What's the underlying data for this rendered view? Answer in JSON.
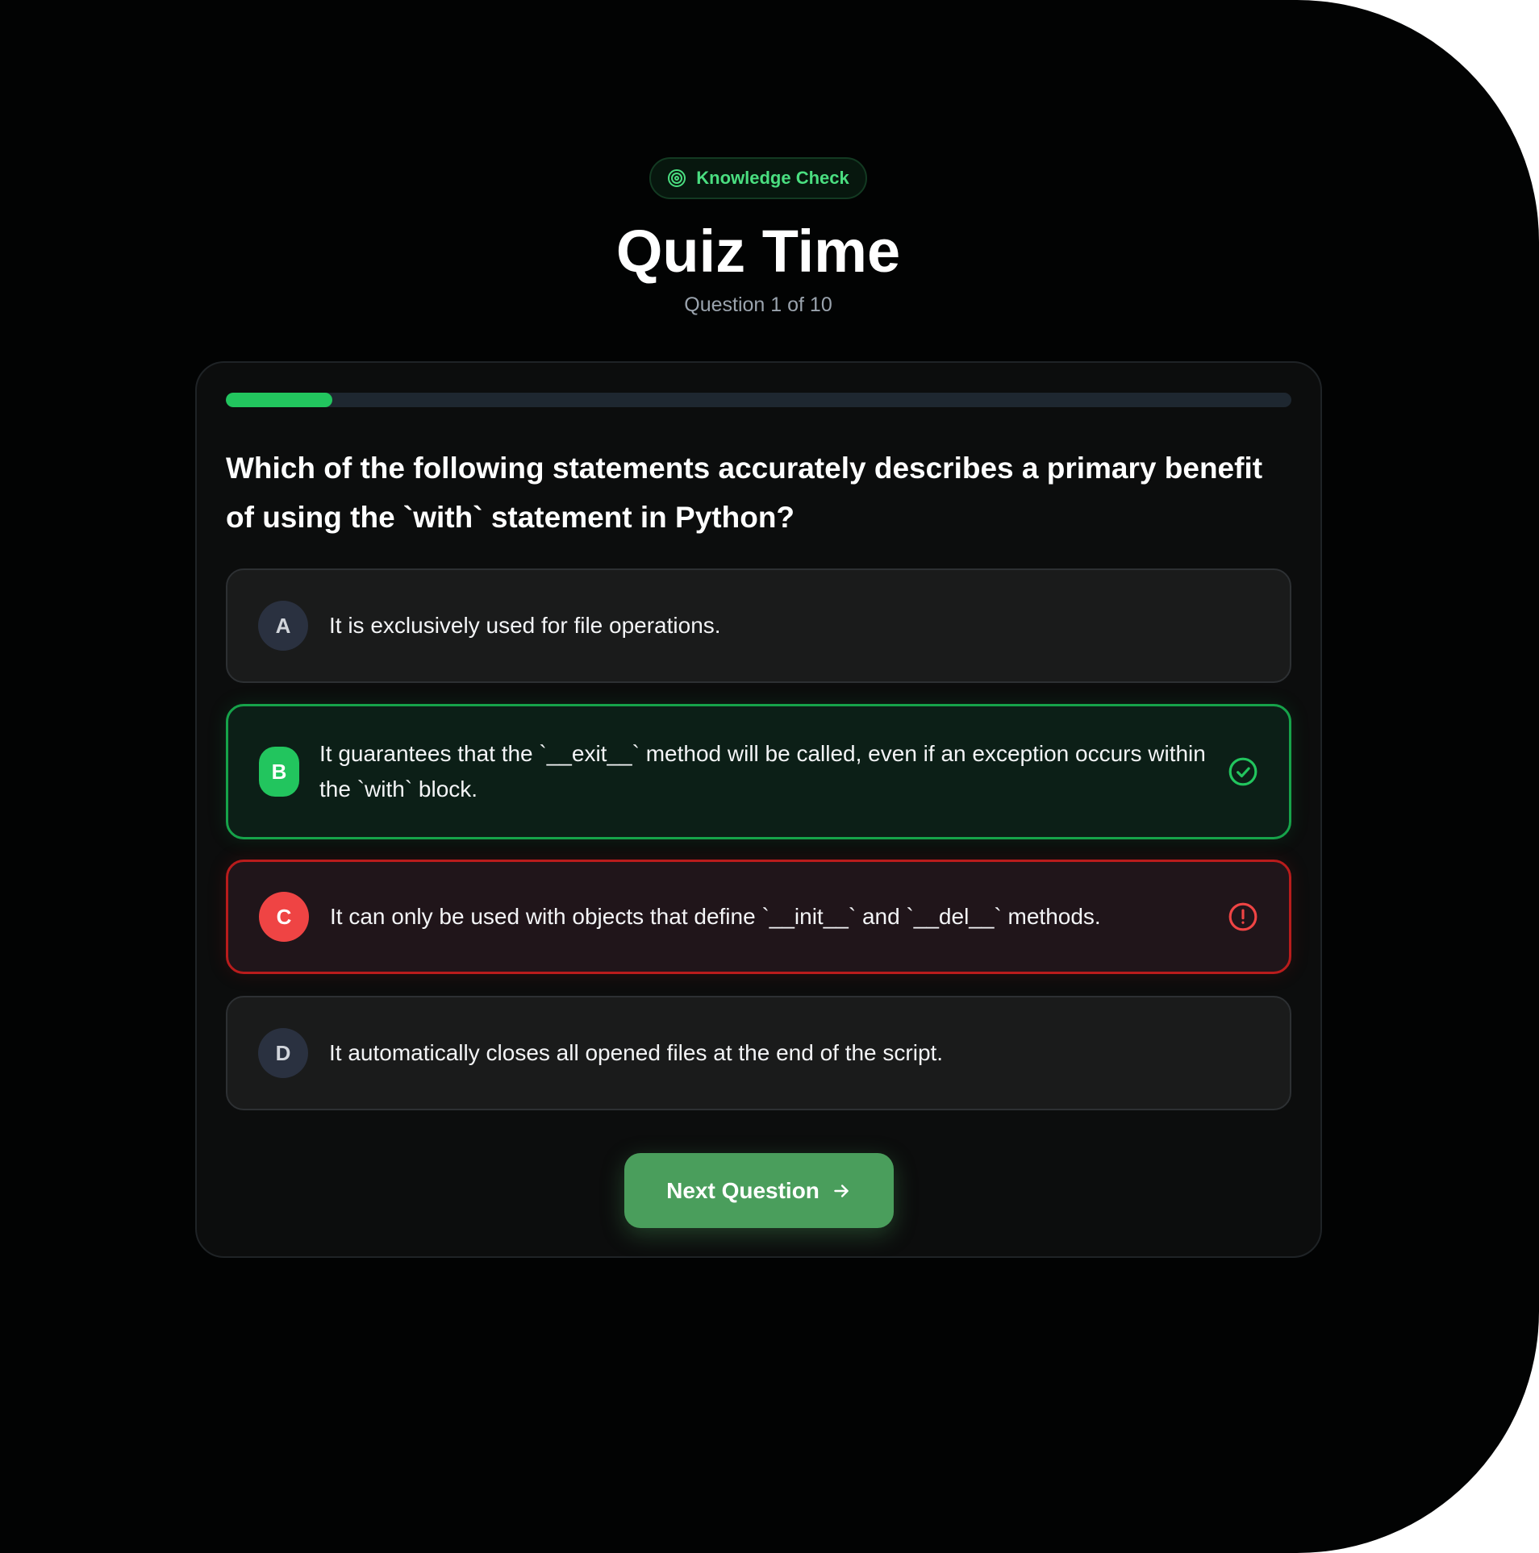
{
  "header": {
    "badge_label": "Knowledge Check",
    "title": "Quiz Time",
    "subtitle": "Question 1 of 10"
  },
  "progress": {
    "fraction": 0.1
  },
  "question": {
    "text": "Which of the following statements accurately describes a primary benefit of using the `with` statement in Python?"
  },
  "options": [
    {
      "letter": "A",
      "text": "It is exclusively used for file operations.",
      "state": "default"
    },
    {
      "letter": "B",
      "text": "It guarantees that the `__exit__` method will be called, even if an exception occurs within the `with` block.",
      "state": "correct"
    },
    {
      "letter": "C",
      "text": "It can only be used with objects that define `__init__` and `__del__` methods.",
      "state": "wrong"
    },
    {
      "letter": "D",
      "text": "It automatically closes all opened files at the end of the script.",
      "state": "default"
    }
  ],
  "actions": {
    "next_label": "Next Question"
  },
  "colors": {
    "accent": "#22c55e",
    "correct": "#16a34a",
    "wrong": "#ef4444",
    "button": "#4a9e5c"
  },
  "icons": {
    "badge": "target-icon",
    "correct": "check-circle-icon",
    "wrong": "alert-circle-icon",
    "next": "arrow-right-icon"
  }
}
